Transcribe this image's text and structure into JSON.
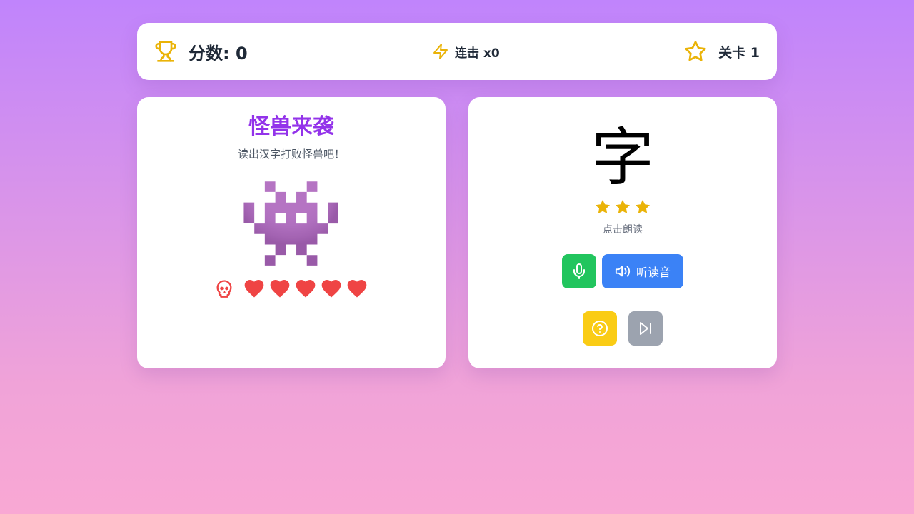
{
  "hud": {
    "score_label": "分数: 0",
    "combo_label": "连击 x0",
    "level_label": "关卡 1"
  },
  "enemy": {
    "name": "怪兽来袭",
    "description": "读出汉字打败怪兽吧！",
    "glyph": "👾",
    "hearts_remaining": 5,
    "hearts_total": 5
  },
  "challenge": {
    "character": "字",
    "difficulty_stars": 3,
    "hint": "点击朗读",
    "play_button_label": "听读音"
  },
  "icons": {
    "score": "trophy-icon",
    "combo": "lightning-icon",
    "level": "star-outline-icon",
    "enemy": "skull-icon",
    "hp": "heart-icon",
    "difficulty": "star-filled-icon",
    "mic": "microphone-icon",
    "play": "speaker-icon",
    "help": "help-circle-icon",
    "skip": "skip-forward-icon"
  },
  "colors": {
    "accent_purple": "#9333ea",
    "gold": "#eab308",
    "heart_red": "#ef4444",
    "mic_green": "#22c55e",
    "play_blue": "#3b82f6",
    "help_yellow": "#facc15",
    "skip_gray": "#9ca3af"
  }
}
